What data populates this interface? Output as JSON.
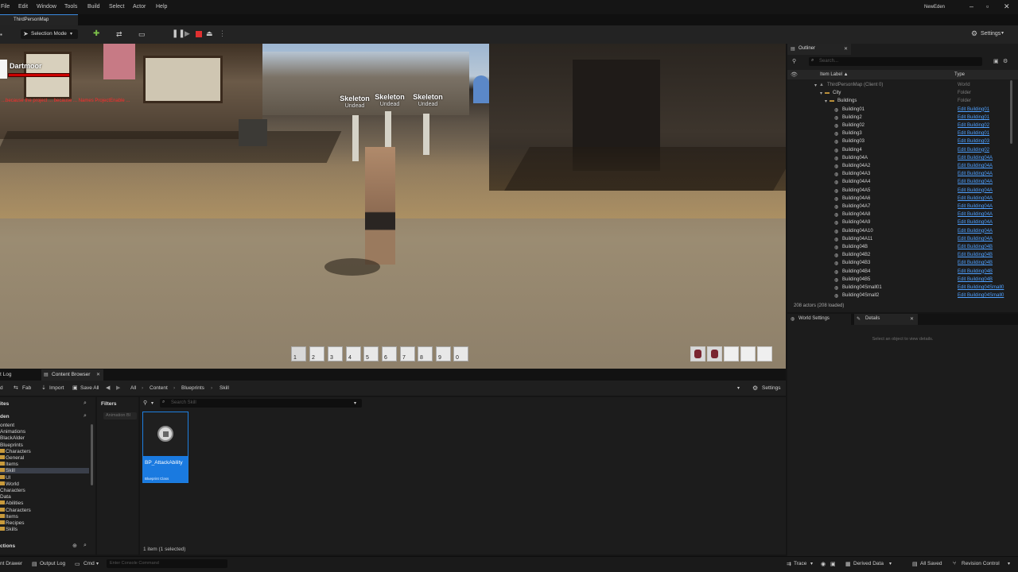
{
  "menu": {
    "items": [
      "File",
      "Edit",
      "Window",
      "Tools",
      "Build",
      "Select",
      "Actor",
      "Help"
    ],
    "project_name": "NewEden"
  },
  "tabs": {
    "level": "ThirdPersonMap"
  },
  "toolbar": {
    "selection_mode": "Selection Mode",
    "settings": "Settings"
  },
  "viewport": {
    "player": {
      "name": "Dartmoor"
    },
    "error_text": "...because the project ... because ... Names ProjectEnable ...",
    "npcs": [
      {
        "name": "Skeleton",
        "type": "Undead"
      },
      {
        "name": "Skeleton",
        "type": "Undead"
      },
      {
        "name": "Skeleton",
        "type": "Undead"
      }
    ],
    "hotbar": [
      "1",
      "2",
      "3",
      "4",
      "5",
      "6",
      "7",
      "8",
      "9",
      "0"
    ],
    "ability_slots": 5,
    "colors": {
      "health_bar": "#cc0000",
      "error_text": "#ff2b2b"
    }
  },
  "outliner": {
    "tab": "Outliner",
    "search_placeholder": "Search...",
    "columns": {
      "label": "Item Label ▲",
      "type": "Type"
    },
    "rows": [
      {
        "label": "ThirdPersonMap (Client 0)",
        "type": "World",
        "depth": 0,
        "kind": "world"
      },
      {
        "label": "City",
        "type": "Folder",
        "depth": 1,
        "kind": "folder"
      },
      {
        "label": "Buildings",
        "type": "Folder",
        "depth": 2,
        "kind": "folder"
      },
      {
        "label": "Building01",
        "link": "Edit Building01",
        "depth": 3,
        "kind": "actor"
      },
      {
        "label": "Building2",
        "link": "Edit Building01",
        "depth": 3,
        "kind": "actor"
      },
      {
        "label": "Building02",
        "link": "Edit Building02",
        "depth": 3,
        "kind": "actor"
      },
      {
        "label": "Building3",
        "link": "Edit Building01",
        "depth": 3,
        "kind": "actor"
      },
      {
        "label": "Building03",
        "link": "Edit Building03",
        "depth": 3,
        "kind": "actor"
      },
      {
        "label": "Building4",
        "link": "Edit Building02",
        "depth": 3,
        "kind": "actor"
      },
      {
        "label": "Building04A",
        "link": "Edit Building04A",
        "depth": 3,
        "kind": "actor"
      },
      {
        "label": "Building04A2",
        "link": "Edit Building04A",
        "depth": 3,
        "kind": "actor"
      },
      {
        "label": "Building04A3",
        "link": "Edit Building04A",
        "depth": 3,
        "kind": "actor"
      },
      {
        "label": "Building04A4",
        "link": "Edit Building04A",
        "depth": 3,
        "kind": "actor"
      },
      {
        "label": "Building04A5",
        "link": "Edit Building04A",
        "depth": 3,
        "kind": "actor"
      },
      {
        "label": "Building04A6",
        "link": "Edit Building04A",
        "depth": 3,
        "kind": "actor"
      },
      {
        "label": "Building04A7",
        "link": "Edit Building04A",
        "depth": 3,
        "kind": "actor"
      },
      {
        "label": "Building04A8",
        "link": "Edit Building04A",
        "depth": 3,
        "kind": "actor"
      },
      {
        "label": "Building04A9",
        "link": "Edit Building04A",
        "depth": 3,
        "kind": "actor"
      },
      {
        "label": "Building04A10",
        "link": "Edit Building04A",
        "depth": 3,
        "kind": "actor"
      },
      {
        "label": "Building04A11",
        "link": "Edit Building04A",
        "depth": 3,
        "kind": "actor"
      },
      {
        "label": "Building04B",
        "link": "Edit Building04B",
        "depth": 3,
        "kind": "actor"
      },
      {
        "label": "Building04B2",
        "link": "Edit Building04B",
        "depth": 3,
        "kind": "actor"
      },
      {
        "label": "Building04B3",
        "link": "Edit Building04B",
        "depth": 3,
        "kind": "actor"
      },
      {
        "label": "Building04B4",
        "link": "Edit Building04B",
        "depth": 3,
        "kind": "actor"
      },
      {
        "label": "Building04B5",
        "link": "Edit Building04B",
        "depth": 3,
        "kind": "actor"
      },
      {
        "label": "Building04Small01",
        "link": "Edit Building04Small0",
        "depth": 3,
        "kind": "actor"
      },
      {
        "label": "Building04Small2",
        "link": "Edit Building04Small0",
        "depth": 3,
        "kind": "actor"
      }
    ],
    "count": "208 actors (208 loaded)"
  },
  "details": {
    "tabs": [
      "World Settings",
      "Details"
    ],
    "hint": "Select an object to view details."
  },
  "content_browser": {
    "tabs": [
      "t Log",
      "Content Browser"
    ],
    "toolbar": {
      "add": "d",
      "fab": "Fab",
      "import": "Import",
      "save_all": "Save All",
      "settings": "Settings"
    },
    "breadcrumb": [
      "All",
      "Content",
      "Blueprints",
      "Skill"
    ],
    "search_placeholder": "Search Skill",
    "left_headers": [
      "ites",
      "den"
    ],
    "filters_label": "Filters",
    "filter_chip": "Animation Bl",
    "tree": [
      {
        "label": "ontent",
        "folder": false,
        "selected": false
      },
      {
        "label": "Animations",
        "folder": false,
        "selected": false
      },
      {
        "label": "BlackAlder",
        "folder": false,
        "selected": false
      },
      {
        "label": "Blueprints",
        "folder": false,
        "selected": false
      },
      {
        "label": "Characters",
        "folder": true,
        "selected": false
      },
      {
        "label": "General",
        "folder": true,
        "selected": false
      },
      {
        "label": "Items",
        "folder": true,
        "selected": false
      },
      {
        "label": "Skill",
        "folder": true,
        "selected": true
      },
      {
        "label": "UI",
        "folder": true,
        "selected": false
      },
      {
        "label": "World",
        "folder": true,
        "selected": false
      },
      {
        "label": "Characters",
        "folder": false,
        "selected": false
      },
      {
        "label": "Data",
        "folder": false,
        "selected": false
      },
      {
        "label": "Abilities",
        "folder": true,
        "selected": false
      },
      {
        "label": "Characters",
        "folder": true,
        "selected": false
      },
      {
        "label": "Items",
        "folder": true,
        "selected": false
      },
      {
        "label": "Recipes",
        "folder": true,
        "selected": false
      },
      {
        "label": "Skills",
        "folder": true,
        "selected": false
      }
    ],
    "collections_label": "ctions",
    "asset": {
      "name": "BP_AttackAbility",
      "type": "Blueprint Class"
    },
    "selection_status": "1 item (1 selected)"
  },
  "statusbar": {
    "content_drawer": "nt Drawer",
    "output_log": "Output Log",
    "cmd": "Cmd",
    "console_placeholder": "Enter Console Command",
    "trace": "Trace",
    "derived_data": "Derived Data",
    "all_saved": "All Saved",
    "revision_control": "Revision Control"
  }
}
